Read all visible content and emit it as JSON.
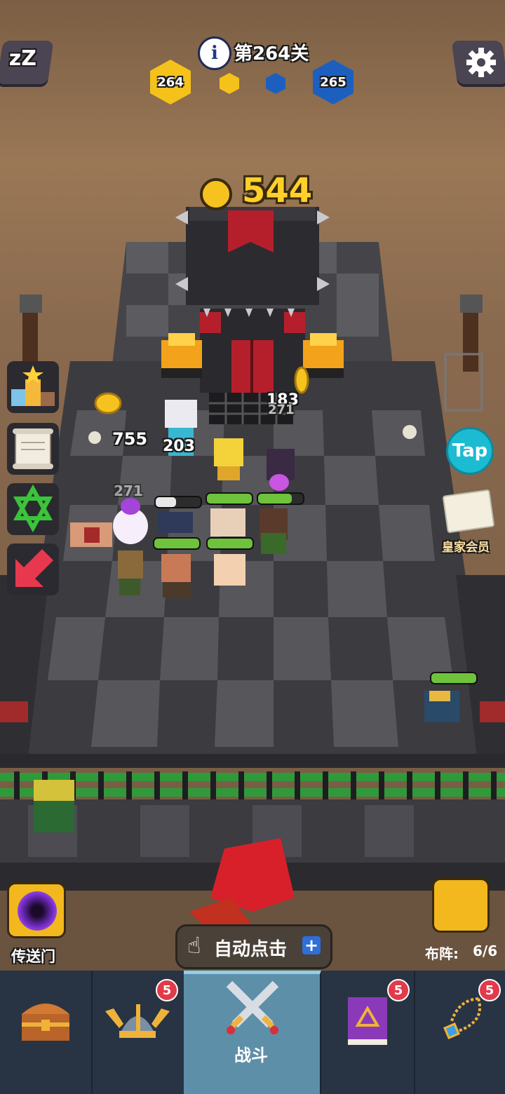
{
  "hud": {
    "sleep_icon": "zzz-icon",
    "level_label": "第264关",
    "info_icon": "info-icon",
    "settings_icon": "gear-icon",
    "current_level": "264",
    "next_level": "265",
    "gold_color": "#f4c21b",
    "blue_color": "#1d5fbf"
  },
  "coins": {
    "value": "544"
  },
  "combat_text": {
    "kills": "755",
    "dmg_a": "203",
    "dmg_b": "183",
    "dmg_c": "271",
    "dmg_d": "271"
  },
  "side_menu": [
    {
      "icon": "podium-icon"
    },
    {
      "icon": "scroll-icon"
    },
    {
      "icon": "hexagram-icon"
    },
    {
      "icon": "arrow-icon"
    }
  ],
  "right_menu": {
    "tap_label": "Tap",
    "royal_label": "皇家会员"
  },
  "portal": {
    "label": "传送门"
  },
  "auto_click": {
    "label": "自动点击"
  },
  "formation": {
    "label": "布阵:",
    "value": "6/6"
  },
  "health_bars": [
    {
      "fill": 0.45,
      "color": "#e8e8e8"
    },
    {
      "fill": 1.0,
      "color": "#6ec23c"
    },
    {
      "fill": 0.75,
      "color": "#6ec23c"
    },
    {
      "fill": 1.0,
      "color": "#6ec23c"
    },
    {
      "fill": 1.0,
      "color": "#6ec23c"
    },
    {
      "fill": 1.0,
      "color": "#6ec23c"
    }
  ],
  "tabs": [
    {
      "icon": "treasure-chest-icon",
      "badge": ""
    },
    {
      "icon": "viking-helmet-icon",
      "badge": "5"
    },
    {
      "icon": "crossed-swords-icon",
      "label": "战斗",
      "active": true
    },
    {
      "icon": "spellbook-icon",
      "badge": "5"
    },
    {
      "icon": "amulet-icon",
      "badge": "5"
    }
  ]
}
